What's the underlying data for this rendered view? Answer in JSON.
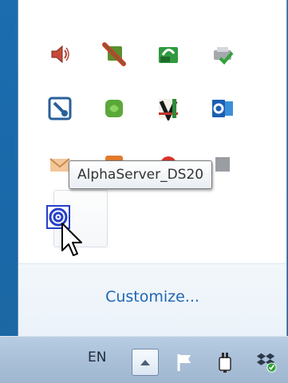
{
  "tooltip": {
    "text": "AlphaServer_DS20"
  },
  "popup": {
    "customize_link": "Customize..."
  },
  "taskbar": {
    "language": "EN"
  },
  "icons": {
    "row1": [
      "speaker-icon",
      "network-error-icon",
      "sync-icon",
      "printer-check-icon"
    ],
    "row2": [
      "tool-icon",
      "green-app-icon",
      "v-app-icon",
      "outlook-icon"
    ],
    "row3": [
      "mail-icon",
      "orange-app-icon",
      "red-app-icon",
      "gray-app-icon"
    ],
    "row4": [
      "alphaserver-icon"
    ],
    "taskbar": [
      "show-hidden-icons-chevron",
      "flag-icon",
      "power-plug-icon",
      "dropbox-sync-icon"
    ]
  },
  "colors": {
    "link": "#1e66b4",
    "desktop": "#1b6db0",
    "taskbar": "#a9c0d8"
  }
}
